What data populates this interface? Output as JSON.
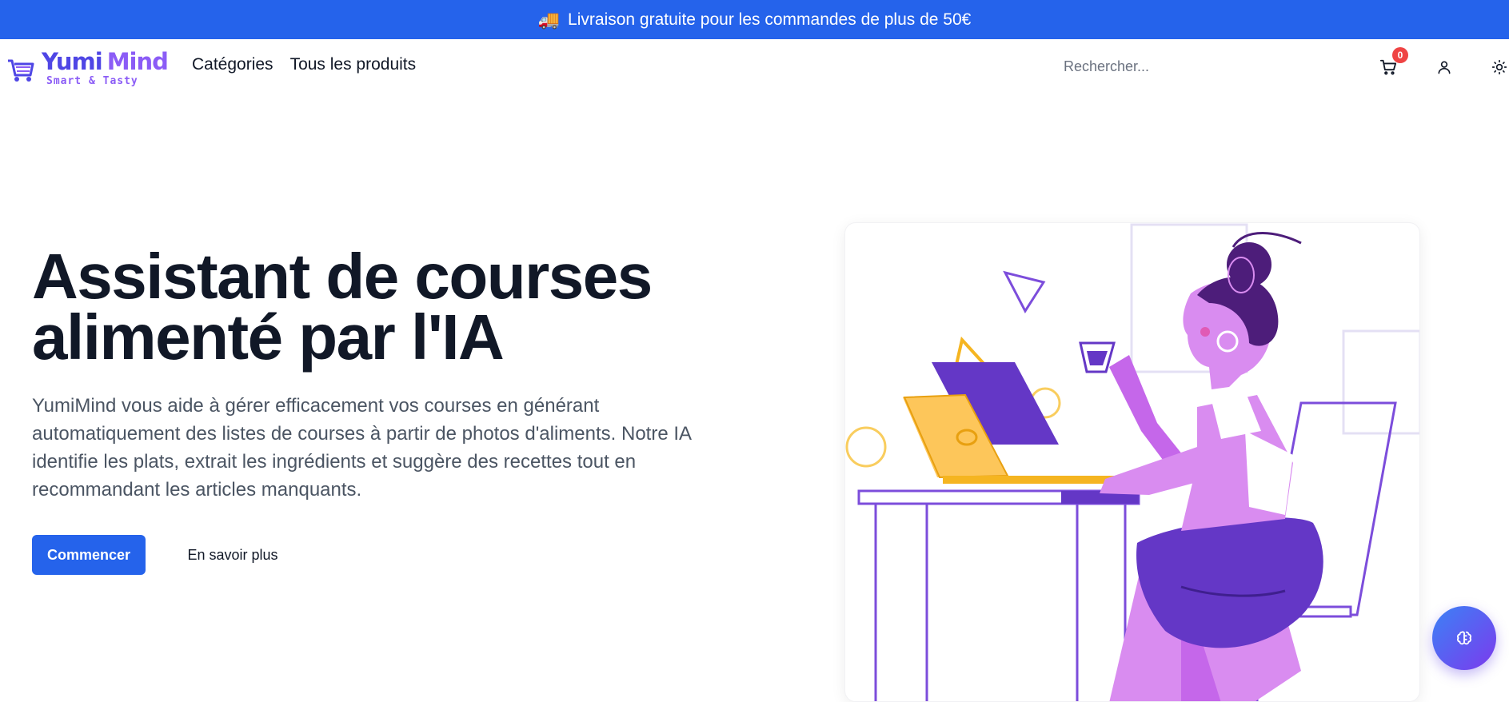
{
  "promo": {
    "icon": "truck-icon",
    "emoji": "🚚",
    "text": "Livraison gratuite pour les commandes de plus de 50€"
  },
  "logo": {
    "name_part1": "Yumi",
    "name_part2": "Mind",
    "tagline": "Smart & Tasty"
  },
  "nav": {
    "links": [
      "Catégories",
      "Tous les produits"
    ]
  },
  "search": {
    "placeholder": "Rechercher..."
  },
  "cart": {
    "count": "0"
  },
  "hero": {
    "title": "Assistant de courses alimenté par l'IA",
    "description": "YumiMind vous aide à gérer efficacement vos courses en générant automatiquement des listes de courses à partir de photos d'aliments. Notre IA identifie les plats, extrait les ingrédients et suggère des recettes tout en recommandant les articles manquants.",
    "primary_button": "Commencer",
    "secondary_button": "En savoir plus"
  },
  "colors": {
    "accent": "#2563eb",
    "purple": "#7c3aed",
    "badge": "#ef4444"
  }
}
